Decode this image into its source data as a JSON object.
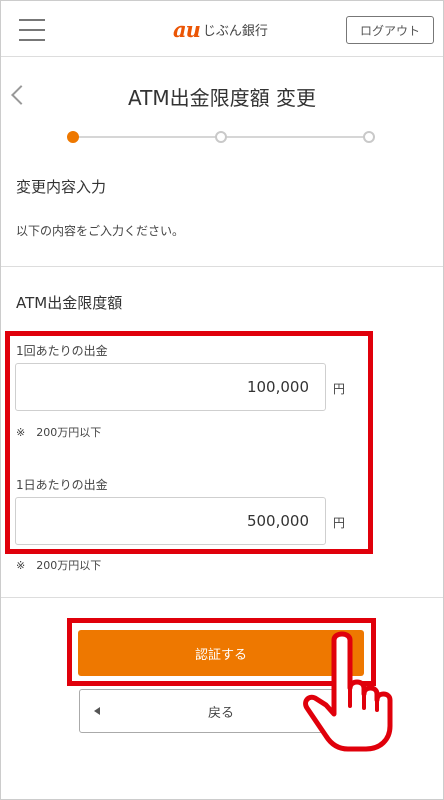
{
  "header": {
    "logo_mark": "au",
    "logo_text": "じぶん銀行",
    "logout_label": "ログアウト"
  },
  "page": {
    "title": "ATM出金限度額 変更"
  },
  "stepper": {
    "total_steps": 3,
    "current_step": 1
  },
  "section1": {
    "heading": "変更内容入力",
    "description": "以下の内容をご入力ください。"
  },
  "section2": {
    "heading": "ATM出金限度額",
    "fields": [
      {
        "label": "1回あたりの出金",
        "value": "100,000",
        "unit": "円",
        "note": "※　200万円以下"
      },
      {
        "label": "1日あたりの出金",
        "value": "500,000",
        "unit": "円",
        "note": "※　200万円以下"
      }
    ]
  },
  "buttons": {
    "auth_label": "認証する",
    "back_label": "戻る"
  },
  "colors": {
    "accent": "#ee7800",
    "highlight": "#e0000b",
    "brand": "#eb5505"
  }
}
